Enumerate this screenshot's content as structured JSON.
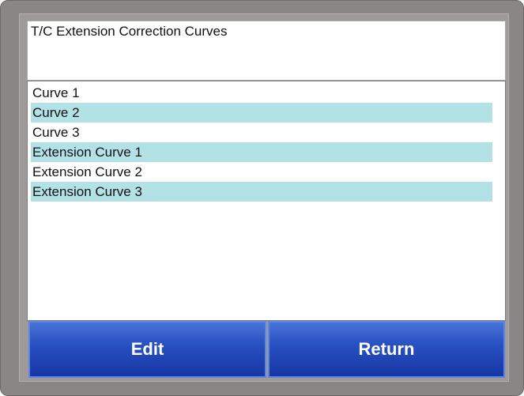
{
  "header": {
    "title": "T/C Extension Correction Curves"
  },
  "list": {
    "items": [
      {
        "label": "Curve 1"
      },
      {
        "label": "Curve 2"
      },
      {
        "label": "Curve 3"
      },
      {
        "label": "Extension Curve 1"
      },
      {
        "label": "Extension Curve 2"
      },
      {
        "label": "Extension Curve 3"
      }
    ]
  },
  "buttons": {
    "edit_label": "Edit",
    "return_label": "Return"
  },
  "colors": {
    "alt_row": "#b3e2e6",
    "button_blue": "#2851c2",
    "bezel": "#8a8686"
  }
}
